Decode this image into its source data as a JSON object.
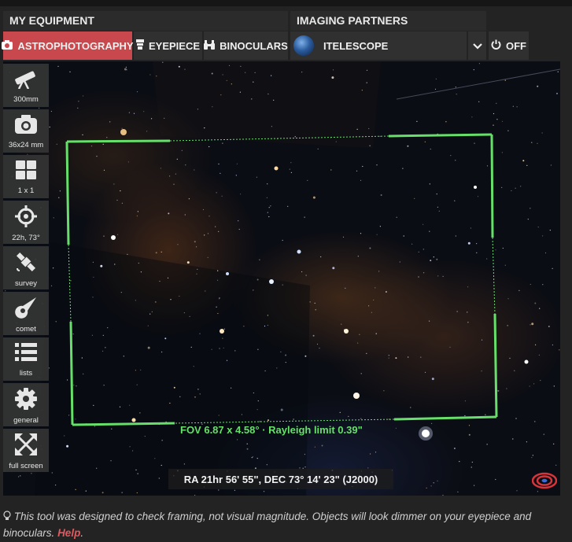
{
  "sections": {
    "equipment": "MY EQUIPMENT",
    "partners": "IMAGING PARTNERS"
  },
  "tabs": {
    "astrophotography": "ASTROPHOTOGRAPHY",
    "eyepiece": "EYEPIECE",
    "binoculars": "BINOCULARS",
    "itelescope": "ITELESCOPE",
    "off": "OFF"
  },
  "sidebar": {
    "telescope": "300mm",
    "camera": "36x24 mm",
    "mosaic": "1 x 1",
    "target": "22h, 73°",
    "survey": "survey",
    "comet": "comet",
    "lists": "lists",
    "general": "general",
    "fullscreen": "full screen"
  },
  "overlay": {
    "fov": "FOV 6.87 x 4.58° · Rayleigh limit 0.39\"",
    "radec": "RA 21hr 56' 55\", DEC 73° 14' 23\" (J2000)"
  },
  "footer": {
    "note": "This tool was designed to check framing, not visual magnitude. Objects will look dimmer on your eyepiece and binoculars.",
    "help": "Help"
  },
  "colors": {
    "active_tab": "#c9484d",
    "fov_frame": "#66e06a",
    "help_link": "#e0595e"
  }
}
